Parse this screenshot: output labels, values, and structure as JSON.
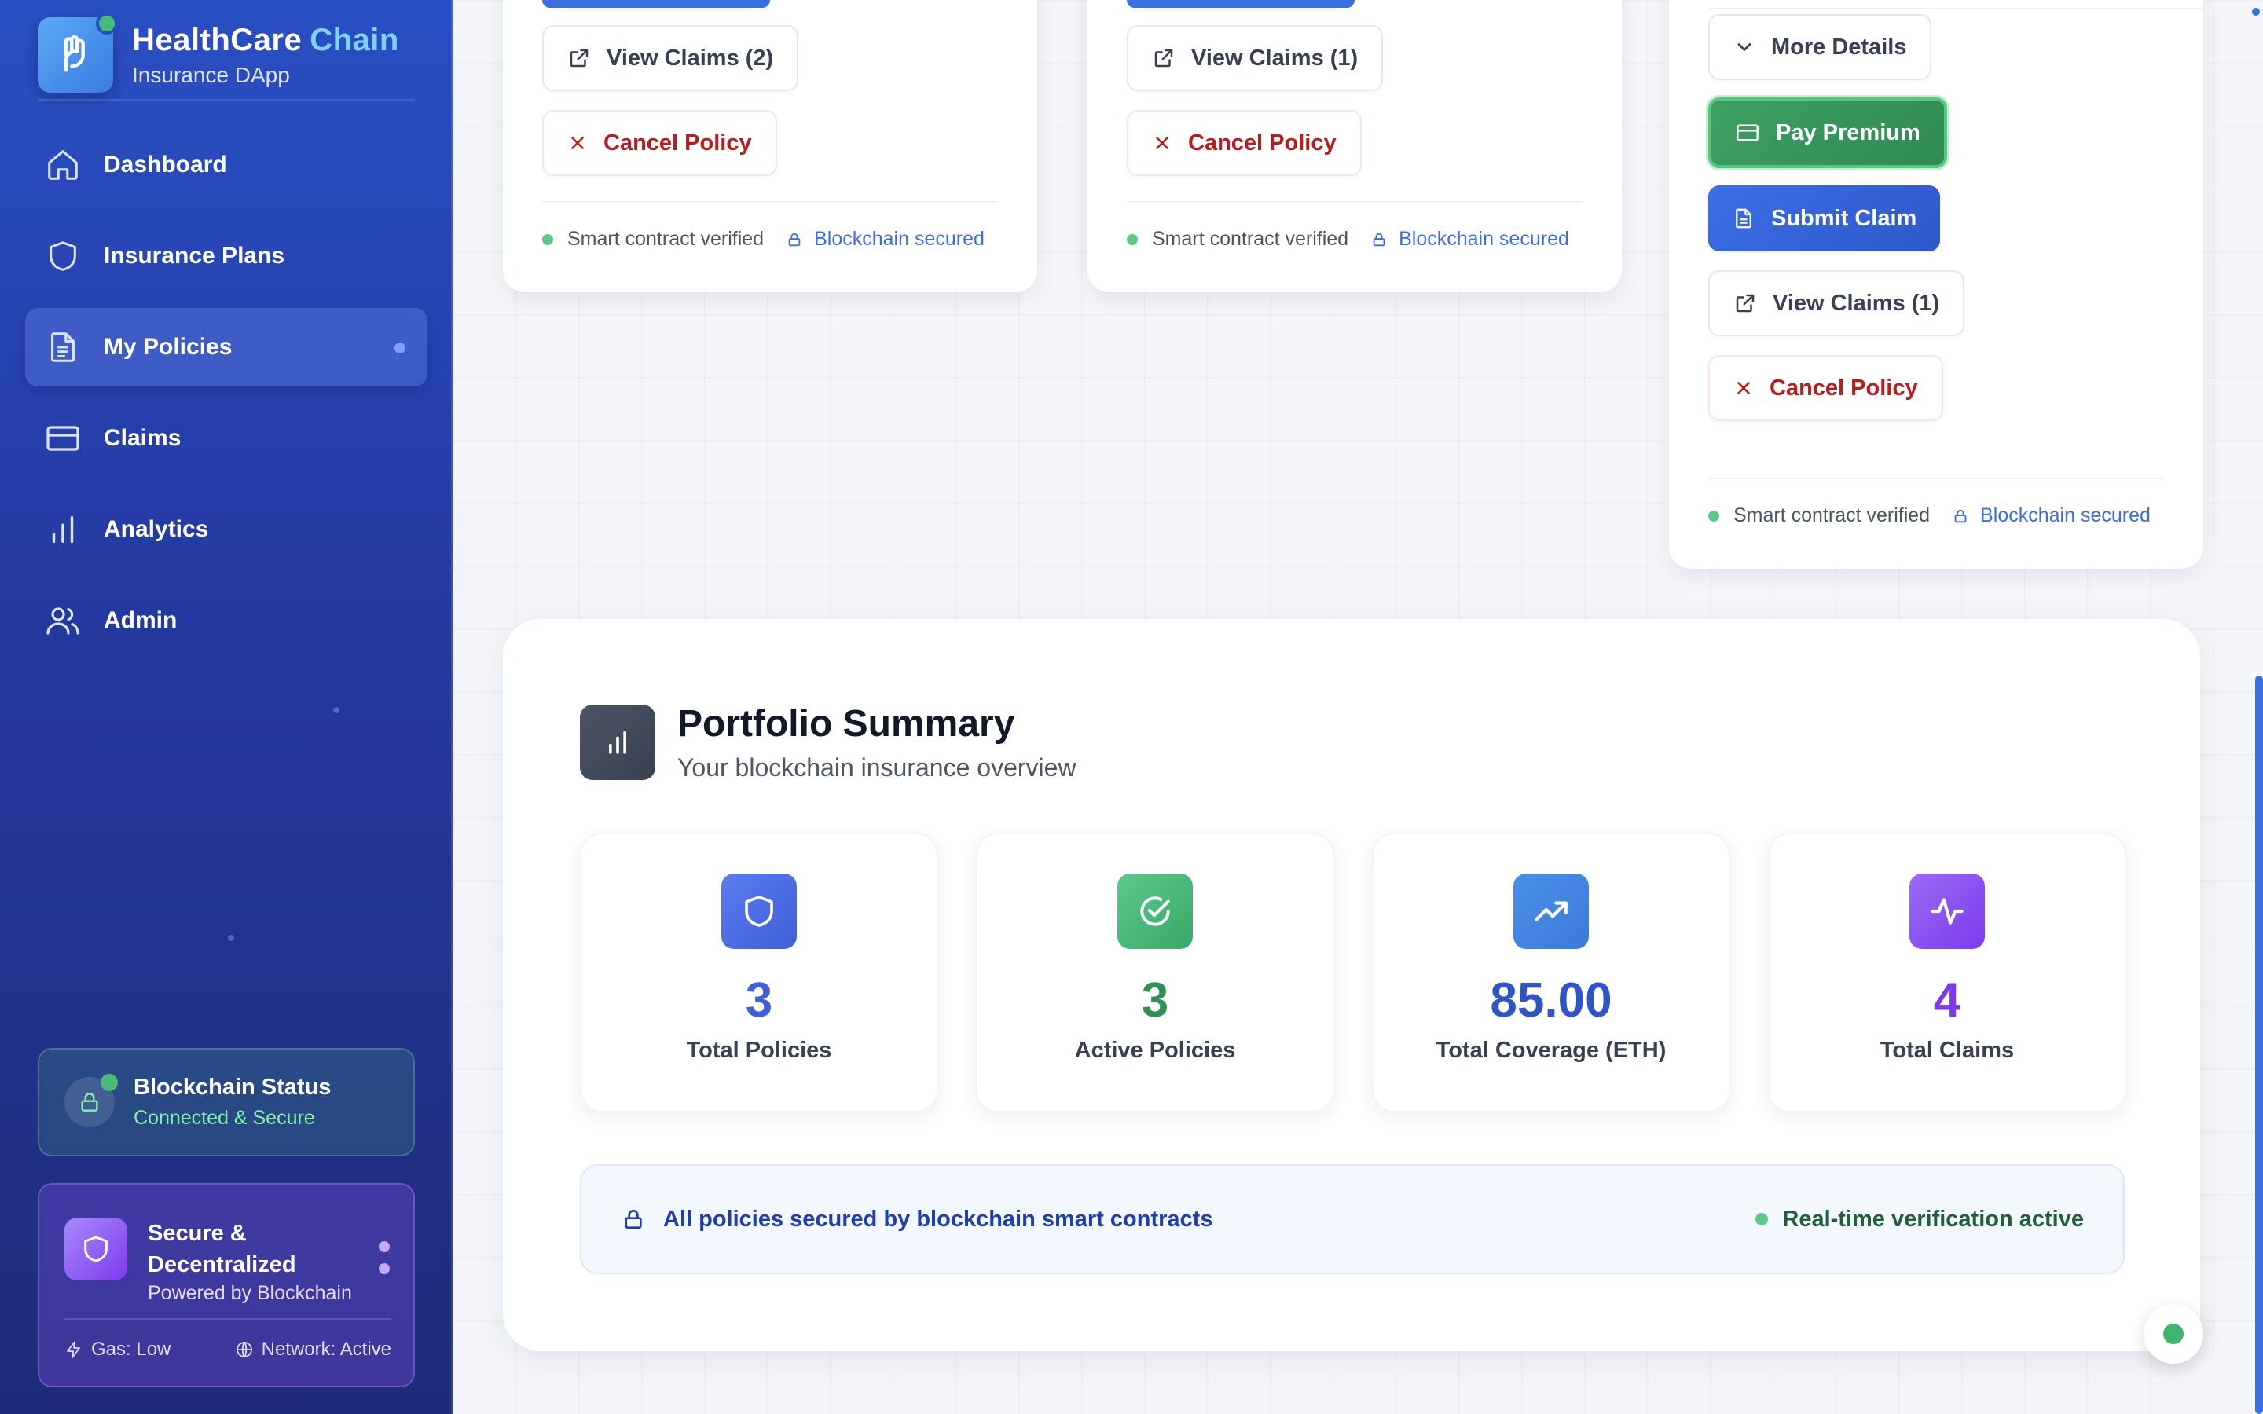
{
  "brand": {
    "title_main": "HealthCare",
    "title_accent": "Chain",
    "subtitle": "Insurance DApp"
  },
  "nav": [
    {
      "label": "Dashboard",
      "icon": "home-icon"
    },
    {
      "label": "Insurance Plans",
      "icon": "shield-icon"
    },
    {
      "label": "My Policies",
      "icon": "document-icon",
      "active": true
    },
    {
      "label": "Claims",
      "icon": "credit-card-icon"
    },
    {
      "label": "Analytics",
      "icon": "bar-chart-icon"
    },
    {
      "label": "Admin",
      "icon": "users-icon"
    }
  ],
  "blockchain_status": {
    "title": "Blockchain Status",
    "subtitle": "Connected & Secure"
  },
  "secure_card": {
    "title": "Secure & Decentralized",
    "subtitle": "Powered by Blockchain",
    "gas": "Gas: Low",
    "network": "Network: Active"
  },
  "policy_cards": [
    {
      "view_claims": "View Claims (2)",
      "cancel": "Cancel Policy",
      "verified": "Smart contract verified",
      "secured": "Blockchain secured"
    },
    {
      "view_claims": "View Claims (1)",
      "cancel": "Cancel Policy",
      "verified": "Smart contract verified",
      "secured": "Blockchain secured"
    },
    {
      "more_details": "More Details",
      "pay_premium": "Pay Premium",
      "submit_claim": "Submit Claim",
      "view_claims": "View Claims (1)",
      "cancel": "Cancel Policy",
      "verified": "Smart contract verified",
      "secured": "Blockchain secured"
    }
  ],
  "summary": {
    "title": "Portfolio Summary",
    "subtitle": "Your blockchain insurance overview",
    "stats": [
      {
        "value": "3",
        "label": "Total Policies",
        "icon": "shield-icon",
        "color": "#3f5fd8"
      },
      {
        "value": "3",
        "label": "Active Policies",
        "icon": "check-circle-icon",
        "color": "#2f8f57"
      },
      {
        "value": "85.00",
        "label": "Total Coverage (ETH)",
        "icon": "trending-up-icon",
        "color": "#2f54c8"
      },
      {
        "value": "4",
        "label": "Total Claims",
        "icon": "activity-icon",
        "color": "#7c3aed"
      }
    ],
    "banner_left": "All policies secured by blockchain smart contracts",
    "banner_right": "Real-time verification active"
  }
}
